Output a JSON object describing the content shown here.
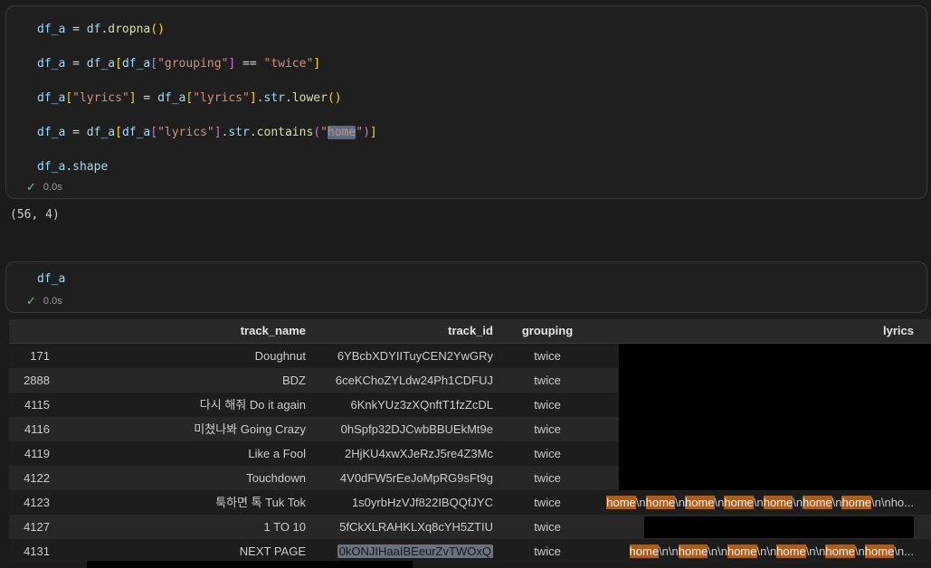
{
  "theme": {
    "page_bg": "#1b1b1b",
    "cell_bg": "#1f1f1f",
    "cell_border": "#37373d",
    "code_variable": "#9CDCFE",
    "code_function": "#DCDCAA",
    "code_string": "#CE9178",
    "code_operator": "#D4D4D4",
    "bracket_level1": "#FFD700",
    "bracket_level2": "#DA70D6",
    "selection_bg": "#5a6b85",
    "search_match_bg": "#a85f1f",
    "success_green": "#73c991",
    "table_header_bg": "#292929",
    "table_row_dark": "#1d1d1d",
    "table_row_light": "#272727",
    "table_text": "#cccccc"
  },
  "cell1": {
    "status": {
      "icon": "✓",
      "time": "0.0s"
    },
    "output": "(56, 4)",
    "code_lines": [
      [
        {
          "t": "df_a",
          "c": "v"
        },
        {
          "t": " = ",
          "c": "o"
        },
        {
          "t": "df",
          "c": "v"
        },
        {
          "t": ".",
          "c": "o"
        },
        {
          "t": "dropna",
          "c": "f"
        },
        {
          "t": "()",
          "c": "b1"
        }
      ],
      [],
      [
        {
          "t": "df_a",
          "c": "v"
        },
        {
          "t": " = ",
          "c": "o"
        },
        {
          "t": "df_a",
          "c": "v"
        },
        {
          "t": "[",
          "c": "b1"
        },
        {
          "t": "df_a",
          "c": "v"
        },
        {
          "t": "[",
          "c": "b2"
        },
        {
          "t": "\"grouping\"",
          "c": "s"
        },
        {
          "t": "]",
          "c": "b2"
        },
        {
          "t": " == ",
          "c": "o"
        },
        {
          "t": "\"twice\"",
          "c": "s"
        },
        {
          "t": "]",
          "c": "b1"
        }
      ],
      [],
      [
        {
          "t": "df_a",
          "c": "v"
        },
        {
          "t": "[",
          "c": "b1"
        },
        {
          "t": "\"lyrics\"",
          "c": "s"
        },
        {
          "t": "]",
          "c": "b1"
        },
        {
          "t": " = ",
          "c": "o"
        },
        {
          "t": "df_a",
          "c": "v"
        },
        {
          "t": "[",
          "c": "b1"
        },
        {
          "t": "\"lyrics\"",
          "c": "s"
        },
        {
          "t": "]",
          "c": "b1"
        },
        {
          "t": ".",
          "c": "o"
        },
        {
          "t": "str",
          "c": "v"
        },
        {
          "t": ".",
          "c": "o"
        },
        {
          "t": "lower",
          "c": "f"
        },
        {
          "t": "()",
          "c": "b1"
        }
      ],
      [],
      [
        {
          "t": "df_a",
          "c": "v"
        },
        {
          "t": " = ",
          "c": "o"
        },
        {
          "t": "df_a",
          "c": "v"
        },
        {
          "t": "[",
          "c": "b1"
        },
        {
          "t": "df_a",
          "c": "v"
        },
        {
          "t": "[",
          "c": "b2"
        },
        {
          "t": "\"lyrics\"",
          "c": "s"
        },
        {
          "t": "]",
          "c": "b2"
        },
        {
          "t": ".",
          "c": "o"
        },
        {
          "t": "str",
          "c": "v"
        },
        {
          "t": ".",
          "c": "o"
        },
        {
          "t": "contains",
          "c": "f"
        },
        {
          "t": "(",
          "c": "b2"
        },
        {
          "t": "\"",
          "c": "s"
        },
        {
          "t": "home",
          "c": "s",
          "sel": true
        },
        {
          "t": "\"",
          "c": "s"
        },
        {
          "t": ")",
          "c": "b2"
        },
        {
          "t": "]",
          "c": "b1"
        }
      ],
      [],
      [
        {
          "t": "df_a",
          "c": "v"
        },
        {
          "t": ".",
          "c": "o"
        },
        {
          "t": "shape",
          "c": "v"
        }
      ]
    ]
  },
  "cell2": {
    "status": {
      "icon": "✓",
      "time": "0.0s"
    },
    "code_lines": [
      [
        {
          "t": "df_a",
          "c": "v"
        }
      ]
    ]
  },
  "table": {
    "headers": [
      "",
      "track_name",
      "track_id",
      "grouping",
      "lyrics"
    ],
    "rows": [
      {
        "index": "171",
        "track_name": "Doughnut",
        "track_id": "6YBcbXDYIITuyCEN2YwGRy",
        "grouping": "twice",
        "lyrics_redacted": "full"
      },
      {
        "index": "2888",
        "track_name": "BDZ",
        "track_id": "6ceKChoZYLdw24Ph1CDFUJ",
        "grouping": "twice",
        "lyrics_redacted": "full"
      },
      {
        "index": "4115",
        "track_name": "다시 해줘 Do it again",
        "track_id": "6KnkYUz3zXQnftT1fzZcDL",
        "grouping": "twice",
        "lyrics_redacted": "full"
      },
      {
        "index": "4116",
        "track_name": "미쳤나봐 Going Crazy",
        "track_id": "0hSpfp32DJCwbBBUEkMt9e",
        "grouping": "twice",
        "lyrics_redacted": "full"
      },
      {
        "index": "4119",
        "track_name": "Like a Fool",
        "track_id": "2HjKU4xwXJeRzJ5re4Z3Mc",
        "grouping": "twice",
        "lyrics_redacted": "full"
      },
      {
        "index": "4122",
        "track_name": "Touchdown",
        "track_id": "4V0dFW5rEeJoMpRG9sFt9g",
        "grouping": "twice",
        "lyrics_redacted": "full"
      },
      {
        "index": "4123",
        "track_name": "툭하면 톡 Tuk Tok",
        "track_id": "1s0yrbHzVJf822IBQQfJYC",
        "grouping": "twice",
        "lyrics_segments": [
          [
            "home",
            true
          ],
          [
            "\\n",
            false
          ],
          [
            "home",
            true
          ],
          [
            "\\n",
            false
          ],
          [
            "home",
            true
          ],
          [
            "\\n",
            false
          ],
          [
            "home",
            true
          ],
          [
            "\\n",
            false
          ],
          [
            "home",
            true
          ],
          [
            "\\n",
            false
          ],
          [
            "home",
            true
          ],
          [
            "\\n",
            false
          ],
          [
            "home",
            true
          ],
          [
            "\\n\\nho...",
            false
          ]
        ]
      },
      {
        "index": "4127",
        "track_name": "1 TO 10",
        "track_id": "5fCkXLRAHKLXq8cYH5ZTIU",
        "grouping": "twice",
        "lyrics_redacted": "partial"
      },
      {
        "index": "4131",
        "track_name": "NEXT PAGE",
        "track_id": "0kONJIHaaIBEeurZvTWOxQ",
        "track_id_selected": true,
        "grouping": "twice",
        "lyrics_segments": [
          [
            "home",
            true
          ],
          [
            "\\n\\n",
            false
          ],
          [
            "home",
            true
          ],
          [
            "\\n\\n",
            false
          ],
          [
            "home",
            true
          ],
          [
            "\\n\\n",
            false
          ],
          [
            "home",
            true
          ],
          [
            "\\n\\n",
            false
          ],
          [
            "home",
            true
          ],
          [
            "\\n",
            false
          ],
          [
            "home",
            true
          ],
          [
            "\\n...",
            false
          ]
        ]
      }
    ]
  }
}
